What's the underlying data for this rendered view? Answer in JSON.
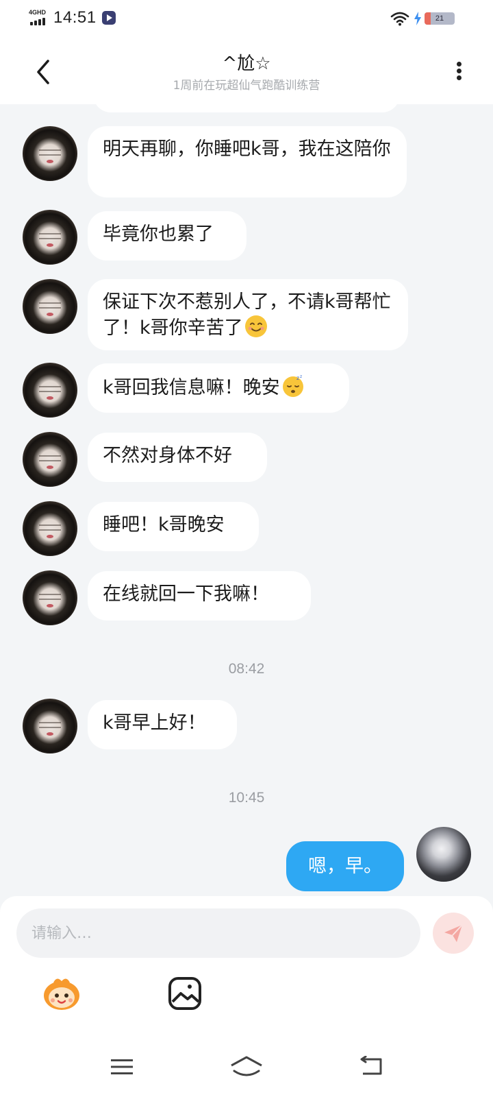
{
  "status_bar": {
    "network": "4GHD",
    "time": "14:51",
    "battery_level": "21",
    "battery_fraction": 0.21,
    "icons": [
      "signal-icon",
      "app-icon",
      "wifi-icon",
      "charging-bolt-icon",
      "battery-icon"
    ]
  },
  "header": {
    "title": "^尬☆",
    "subtitle": "1周前在玩超仙气跑酷训练营",
    "icons": [
      "back-arrow-icon",
      "more-vertical-icon"
    ]
  },
  "messages": [
    {
      "sender": "other",
      "text": "明天再聊，你睡吧k哥，我在这陪你"
    },
    {
      "sender": "other",
      "text": "毕竟你也累了"
    },
    {
      "sender": "other",
      "text": "保证下次不惹别人了，不请k哥帮忙了！k哥你辛苦了",
      "emoji": "smiling-face-emoji"
    },
    {
      "sender": "other",
      "text": "k哥回我信息嘛！晚安",
      "emoji": "sleeping-face-emoji"
    },
    {
      "sender": "other",
      "text": "不然对身体不好"
    },
    {
      "sender": "other",
      "text": "睡吧！k哥晚安"
    },
    {
      "sender": "other",
      "text": "在线就回一下我嘛！"
    },
    {
      "sender": "other",
      "text": "k哥早上好！"
    },
    {
      "sender": "self",
      "text": "嗯，早。"
    }
  ],
  "timestamps": [
    "08:42",
    "10:45"
  ],
  "composer": {
    "placeholder": "请输入…",
    "icons": [
      "send-icon",
      "sticker-icon",
      "image-icon"
    ]
  },
  "nav": {
    "icons": [
      "menu-icon",
      "home-icon",
      "back-icon"
    ]
  },
  "colors": {
    "background": "#f3f5f7",
    "self_bubble": "#2ea8f3",
    "other_bubble": "#ffffff",
    "send_button": "#fbe2e0",
    "send_icon": "#f4a7a2"
  }
}
